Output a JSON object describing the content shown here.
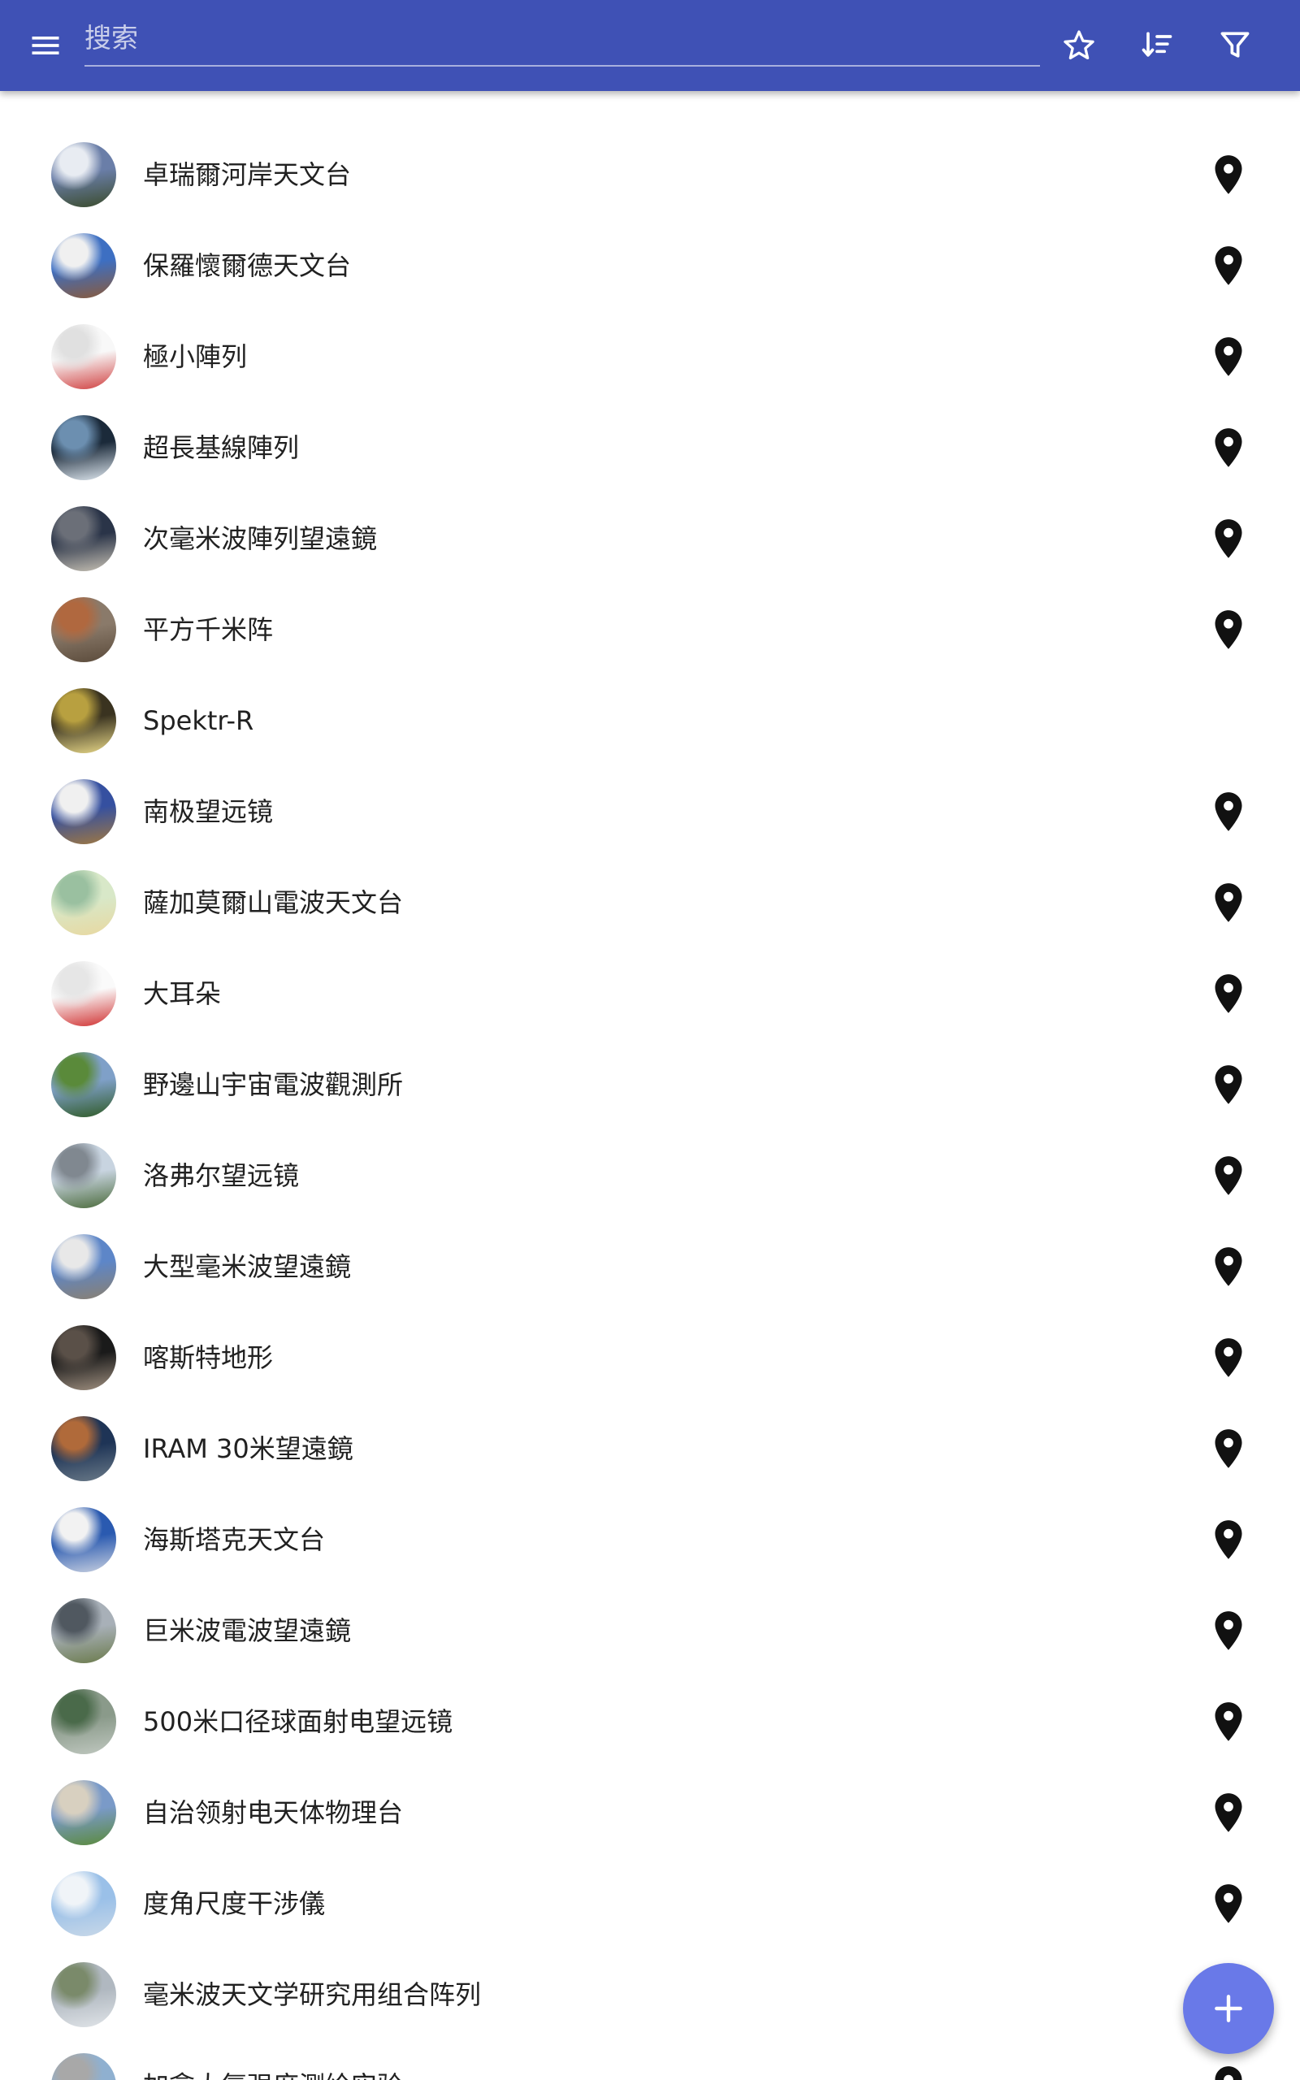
{
  "theme": {
    "primary": "#3f51b5",
    "fab": "#6979e8",
    "text": "#212121"
  },
  "toolbar": {
    "menu_icon": "menu-icon",
    "search_placeholder": "搜索",
    "search_value": "",
    "star_icon": "star-outline-icon",
    "sort_icon": "sort-icon",
    "filter_icon": "filter-icon"
  },
  "items": [
    {
      "label": "卓瑞爾河岸天文台",
      "has_location": true,
      "thumb_colors": [
        "#6a7ea8",
        "#e8ecf2",
        "#3a4b2a"
      ]
    },
    {
      "label": "保羅懷爾德天文台",
      "has_location": true,
      "thumb_colors": [
        "#3d6fc2",
        "#f0f0f0",
        "#8a5a3a"
      ]
    },
    {
      "label": "極小陣列",
      "has_location": true,
      "thumb_colors": [
        "#f8f8f8",
        "#e0e0e0",
        "#d04040"
      ]
    },
    {
      "label": "超長基線陣列",
      "has_location": true,
      "thumb_colors": [
        "#1b2a3a",
        "#6c8fb0",
        "#dfe8f0"
      ]
    },
    {
      "label": "次毫米波陣列望遠鏡",
      "has_location": true,
      "thumb_colors": [
        "#2a3448",
        "#6b6f78",
        "#c8c2b5"
      ]
    },
    {
      "label": "平方千米阵",
      "has_location": true,
      "thumb_colors": [
        "#8a7a6a",
        "#b0683f",
        "#5a4a3a"
      ]
    },
    {
      "label": "Spektr-R",
      "has_location": false,
      "thumb_colors": [
        "#3a3320",
        "#b8a040",
        "#e8d888"
      ]
    },
    {
      "label": "南极望远镜",
      "has_location": true,
      "thumb_colors": [
        "#3550a0",
        "#f0f0f0",
        "#a07840"
      ]
    },
    {
      "label": "薩加莫爾山電波天文台",
      "has_location": true,
      "thumb_colors": [
        "#d8e8c8",
        "#9ac0a0",
        "#e8d8a0"
      ]
    },
    {
      "label": "大耳朵",
      "has_location": true,
      "thumb_colors": [
        "#fafafa",
        "#e6e6e6",
        "#d03030"
      ]
    },
    {
      "label": "野邊山宇宙電波觀測所",
      "has_location": true,
      "thumb_colors": [
        "#7fa0c8",
        "#5a8a3a",
        "#2f5a25"
      ]
    },
    {
      "label": "洛弗尔望远镜",
      "has_location": true,
      "thumb_colors": [
        "#c8d4e0",
        "#808890",
        "#4a6a3a"
      ]
    },
    {
      "label": "大型毫米波望遠鏡",
      "has_location": true,
      "thumb_colors": [
        "#5d86c8",
        "#e8e8e8",
        "#8a8070"
      ]
    },
    {
      "label": "喀斯特地形",
      "has_location": true,
      "thumb_colors": [
        "#1a1a1a",
        "#5a5048",
        "#a09080"
      ]
    },
    {
      "label": "IRAM 30米望遠鏡",
      "has_location": true,
      "thumb_colors": [
        "#1e3456",
        "#b06a3a",
        "#6a7a88"
      ]
    },
    {
      "label": "海斯塔克天文台",
      "has_location": true,
      "thumb_colors": [
        "#2a5ab0",
        "#f2f2f2",
        "#c8d0e0"
      ]
    },
    {
      "label": "巨米波電波望遠鏡",
      "has_location": true,
      "thumb_colors": [
        "#a8b0b8",
        "#505860",
        "#6a7a4a"
      ]
    },
    {
      "label": "500米口径球面射电望远镜",
      "has_location": true,
      "thumb_colors": [
        "#8a9a8a",
        "#4a6a4a",
        "#c0c8c0"
      ]
    },
    {
      "label": "自治领射电天体物理台",
      "has_location": true,
      "thumb_colors": [
        "#7a9ac8",
        "#d8d0c0",
        "#5a8a3a"
      ]
    },
    {
      "label": "度角尺度干涉儀",
      "has_location": true,
      "thumb_colors": [
        "#9ac0e8",
        "#f0f4f8",
        "#c8d8e8"
      ]
    },
    {
      "label": "毫米波天文学研究用组合阵列",
      "has_location": false,
      "thumb_colors": [
        "#b0b8c0",
        "#7a8a6a",
        "#e0e4e8"
      ]
    },
    {
      "label": "加拿大氫强度测绘实验",
      "has_location": true,
      "thumb_colors": [
        "#8fb0d0",
        "#a8a8a8",
        "#607060"
      ]
    }
  ],
  "fab": {
    "icon": "add-icon"
  }
}
